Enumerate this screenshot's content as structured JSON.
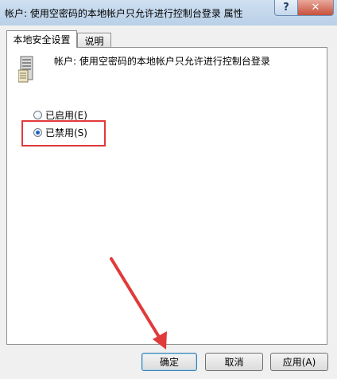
{
  "window": {
    "title": "帐户: 使用空密码的本地帐户只允许进行控制台登录 属性",
    "help_label": "?",
    "close_label": "✕"
  },
  "tabs": [
    {
      "label": "本地安全设置",
      "active": true
    },
    {
      "label": "说明",
      "active": false
    }
  ],
  "policy": {
    "icon": "server-policy-icon",
    "name": "帐户: 使用空密码的本地帐户只允许进行控制台登录"
  },
  "options": [
    {
      "label": "已启用(E)",
      "checked": false
    },
    {
      "label": "已禁用(S)",
      "checked": true
    }
  ],
  "buttons": {
    "ok": "确定",
    "cancel": "取消",
    "apply": "应用(A)"
  },
  "annotation": {
    "color": "#e03a3a"
  }
}
